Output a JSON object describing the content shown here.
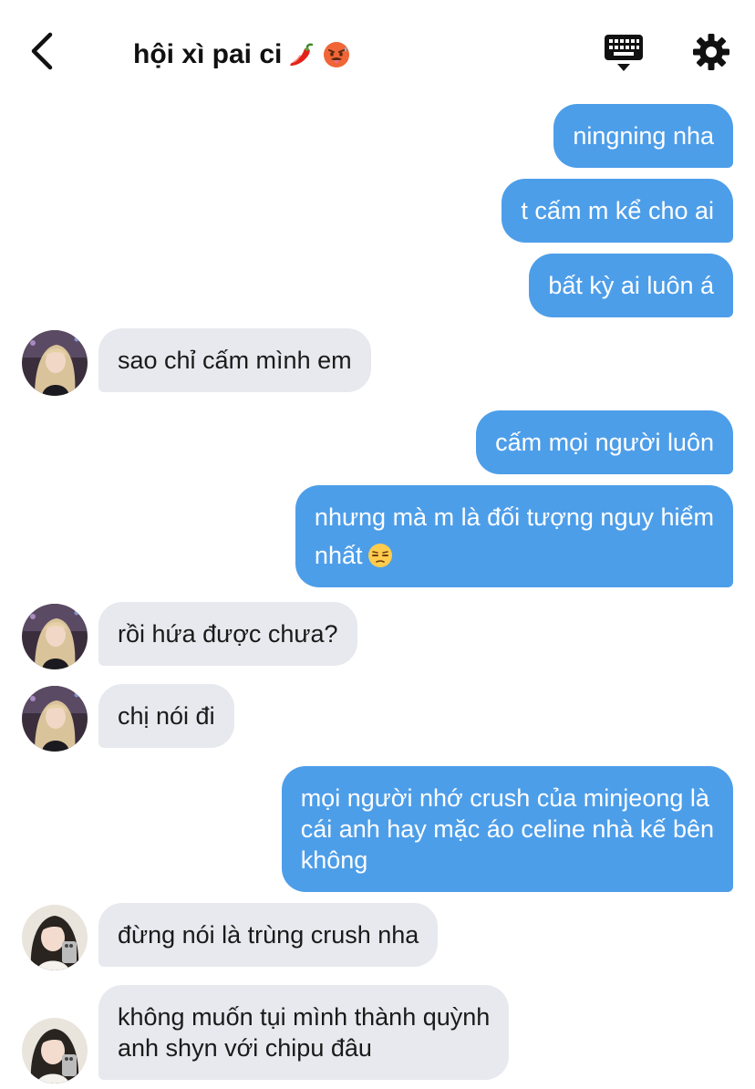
{
  "header": {
    "title": "hội xì pai ci",
    "title_emojis": [
      "hot-pepper-emoji",
      "hot-face-emoji"
    ],
    "back_icon": "chevron-left-icon",
    "keyboard_icon": "keyboard-icon",
    "settings_icon": "gear-icon"
  },
  "colors": {
    "sent_bubble": "#4d9ee9",
    "received_bubble": "#e7e9ee",
    "background": "#ffffff"
  },
  "messages": [
    {
      "side": "sent",
      "text": "ningning nha"
    },
    {
      "side": "sent",
      "text": "t cấm m kể cho ai"
    },
    {
      "side": "sent",
      "text": "bất kỳ ai luôn á"
    },
    {
      "side": "received",
      "sender_avatar": "avatar-blonde",
      "text": "sao chỉ cấm mình em"
    },
    {
      "side": "sent",
      "text": "cấm mọi người luôn"
    },
    {
      "side": "sent",
      "lines": [
        "nhưng mà m là đối tượng nguy hiểm",
        "nhất"
      ],
      "emoji": "unamused-face-emoji"
    },
    {
      "side": "received",
      "sender_avatar": "avatar-blonde",
      "text": "rồi hứa được chưa?"
    },
    {
      "side": "received",
      "sender_avatar": "avatar-blonde",
      "text": "chị nói đi"
    },
    {
      "side": "sent",
      "lines": [
        "mọi người nhớ crush của minjeong là",
        "cái anh hay mặc áo celine nhà kế bên",
        "không"
      ]
    },
    {
      "side": "received",
      "sender_avatar": "avatar-dark-hair",
      "text": "đừng nói là trùng crush nha"
    },
    {
      "side": "received",
      "sender_avatar": "avatar-dark-hair",
      "lines": [
        "không muốn tụi mình thành quỳnh",
        "anh shyn với chipu đâu"
      ]
    }
  ]
}
